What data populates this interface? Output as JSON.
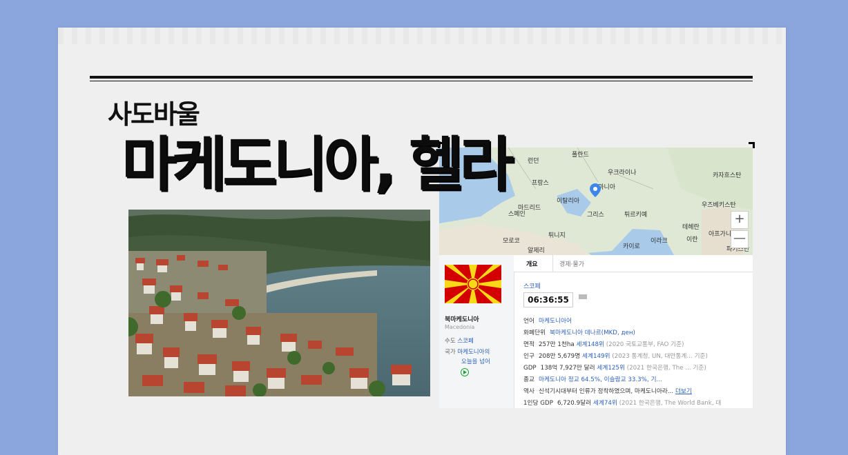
{
  "kicker": "사도바울",
  "headline": "마케도니아, 헬라",
  "map": {
    "labels": [
      "런던",
      "폴란드",
      "우크라이나",
      "카자흐스탄",
      "프랑스",
      "루마니아",
      "마드리드",
      "스페인",
      "이탈리아",
      "그리스",
      "튀르키예",
      "우즈베키스탄",
      "테헤란",
      "모로코",
      "튀니지",
      "이란",
      "아프가니스탄",
      "알제리",
      "카이로",
      "이라크",
      "파키스탄"
    ],
    "zoom_in": "+",
    "zoom_out": "—"
  },
  "country": {
    "name_ko": "북마케도니아",
    "name_en": "Macedonia",
    "capital_label": "수도",
    "capital": "스코페",
    "anthem_label": "국가",
    "anthem_1": "마케도니아의",
    "anthem_2": "오늘을 넘어"
  },
  "tabs": [
    "개요",
    "경제·물가"
  ],
  "timezone": "스코페",
  "clock": "06:36:55",
  "rows": [
    {
      "k": "언어",
      "lnk": "마케도니아어",
      "rest": ""
    },
    {
      "k": "화폐단위",
      "lnk": "북마케도니아 데나르(MKD, ден)",
      "rest": ""
    },
    {
      "k": "면적",
      "v": "257만 1천ha",
      "lnk": "세계148위",
      "sub": "(2020 국토교통부, FAO 기준)"
    },
    {
      "k": "인구",
      "v": "208만 5,679명",
      "lnk": "세계149위",
      "sub": "(2023 통계청, UN, 대만통계... 기준)"
    },
    {
      "k": "GDP",
      "v": "138억 7,927만 달러",
      "lnk": "세계125위",
      "sub": "(2021 한국은행, The ...  기준)"
    },
    {
      "k": "종교",
      "lnk": "마케도니아 정교 64.5%, 이슬람교 33.3%, 기...",
      "rest": ""
    },
    {
      "k": "역사",
      "v": "신석기시대부터 인류가 정착하였으며, 마케도니아라...",
      "more": "더보기"
    },
    {
      "k": "1인당 GDP",
      "v": "6,720.9달러",
      "lnk": "세계74위",
      "sub": "(2021 한국은행, The World Bank, 대"
    }
  ]
}
